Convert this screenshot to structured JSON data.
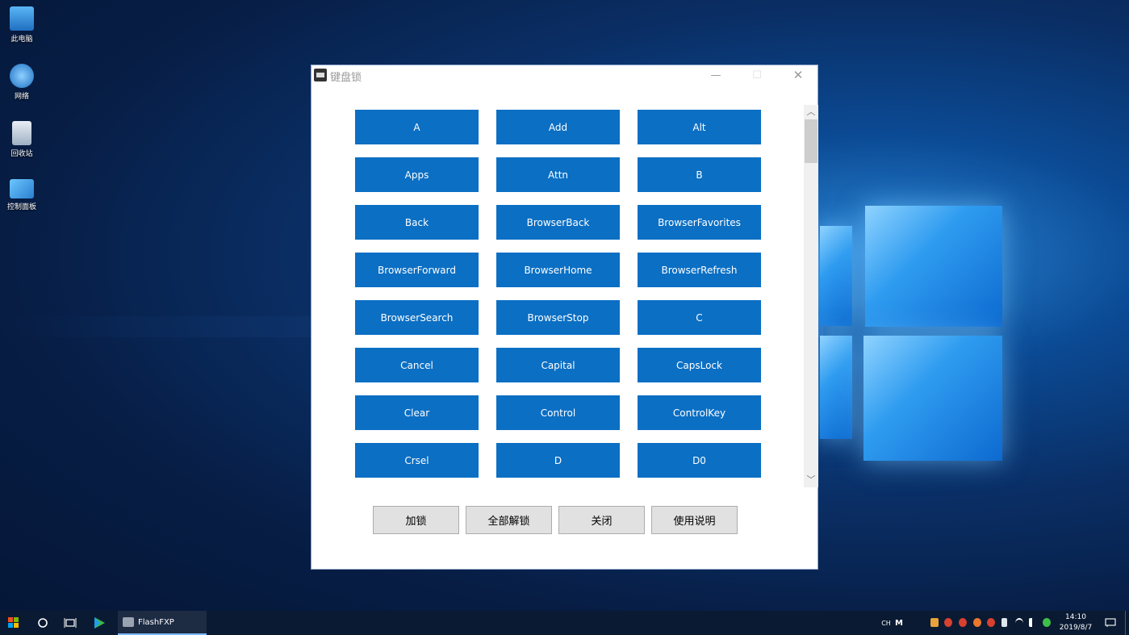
{
  "desktop": {
    "icons": [
      {
        "label": "此电脑",
        "icon": "computer-icon"
      },
      {
        "label": "网络",
        "icon": "network-icon"
      },
      {
        "label": "回收站",
        "icon": "recycle-bin-icon"
      },
      {
        "label": "控制面板",
        "icon": "control-panel-icon"
      }
    ]
  },
  "window": {
    "title": "键盘锁",
    "controls": {
      "minimize": "—",
      "maximize": "☐",
      "close": "✕"
    },
    "keys": [
      "A",
      "Add",
      "Alt",
      "Apps",
      "Attn",
      "B",
      "Back",
      "BrowserBack",
      "BrowserFavorites",
      "BrowserForward",
      "BrowserHome",
      "BrowserRefresh",
      "BrowserSearch",
      "BrowserStop",
      "C",
      "Cancel",
      "Capital",
      "CapsLock",
      "Clear",
      "Control",
      "ControlKey",
      "Crsel",
      "D",
      "D0"
    ],
    "buttons": {
      "lock": "加锁",
      "unlock_all": "全部解锁",
      "close": "关闭",
      "help": "使用说明"
    },
    "scrollbar": {
      "up": "︿",
      "down": "﹀"
    }
  },
  "taskbar": {
    "app_label": "FlashFXP",
    "ime": "CH",
    "ime_mode": "M",
    "time": "14:10",
    "date": "2019/8/7"
  },
  "colors": {
    "key_bg": "#0b6fc4",
    "taskbar_bg": "#0a1a33"
  }
}
